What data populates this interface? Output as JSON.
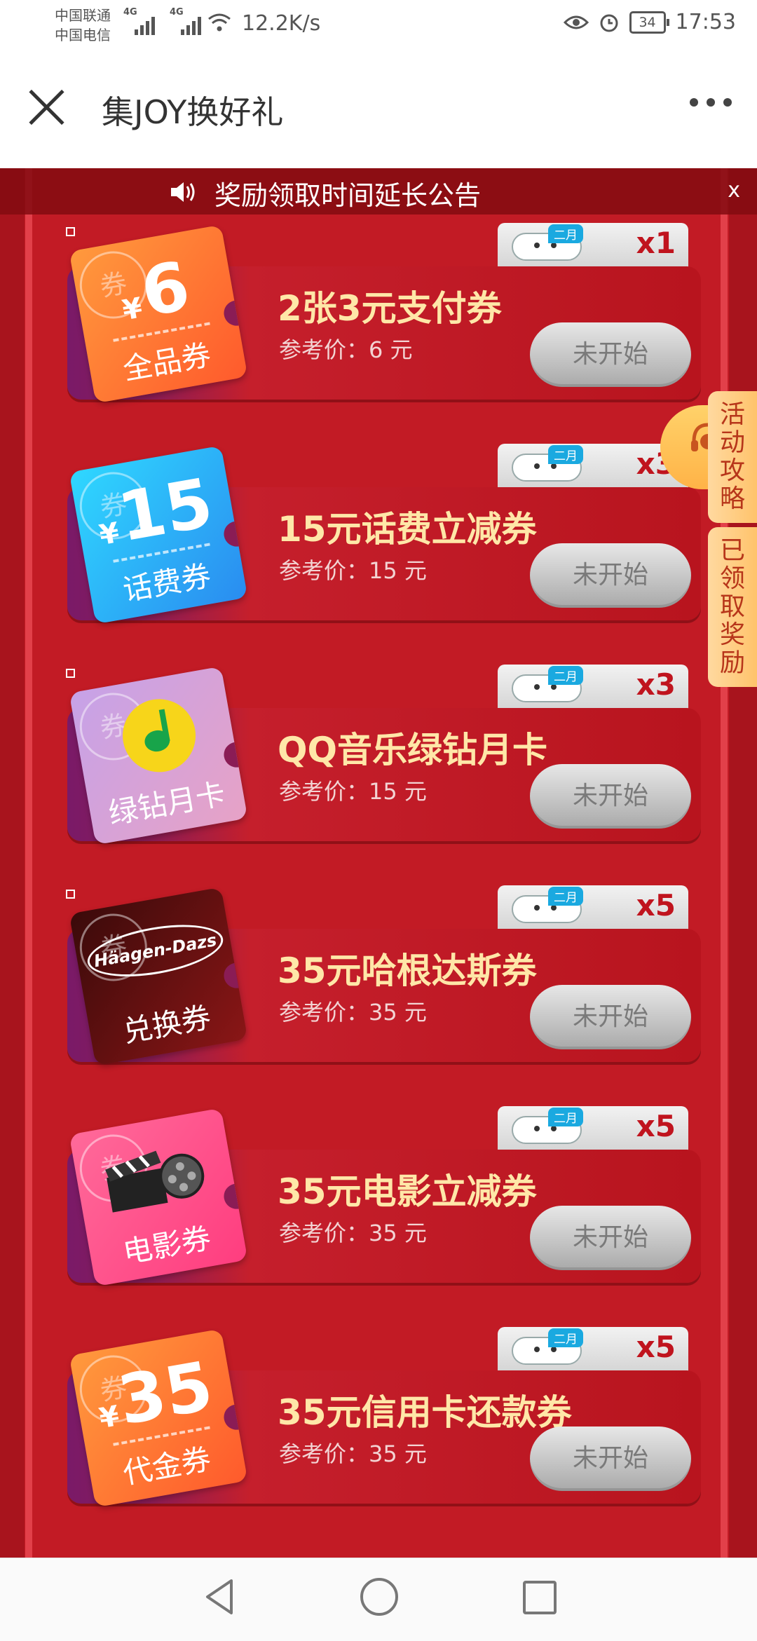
{
  "status_bar": {
    "carrier1": "中国联通",
    "carrier2": "中国电信",
    "net1": "4G",
    "net2": "4G",
    "speed": "12.2K/s",
    "battery": "34",
    "time": "17:53"
  },
  "header": {
    "title": "集JOY换好礼"
  },
  "notice": {
    "text": "奖励领取时间延长公告",
    "close": "x"
  },
  "side": {
    "strategy": "活动攻略",
    "claimed": "已领取奖励"
  },
  "items": [
    {
      "coupon_amount": "6",
      "coupon_label": "全品券",
      "name": "2张3元支付券",
      "ref_price": "参考价：6 元",
      "month_badge": "二月",
      "count": "x1",
      "button": "未开始"
    },
    {
      "coupon_amount": "15",
      "coupon_label": "话费券",
      "name": "15元话费立减券",
      "ref_price": "参考价：15 元",
      "month_badge": "二月",
      "count": "x3",
      "button": "未开始"
    },
    {
      "coupon_amount": "",
      "coupon_label": "绿钻月卡",
      "name": "QQ音乐绿钻月卡",
      "ref_price": "参考价：15 元",
      "month_badge": "二月",
      "count": "x3",
      "button": "未开始"
    },
    {
      "coupon_amount": "Häagen-Dazs",
      "coupon_label": "兑换券",
      "name": "35元哈根达斯券",
      "ref_price": "参考价：35 元",
      "month_badge": "二月",
      "count": "x5",
      "button": "未开始"
    },
    {
      "coupon_amount": "",
      "coupon_label": "电影券",
      "name": "35元电影立减券",
      "ref_price": "参考价：35 元",
      "month_badge": "二月",
      "count": "x5",
      "button": "未开始"
    },
    {
      "coupon_amount": "35",
      "coupon_label": "代金券",
      "name": "35元信用卡还款券",
      "ref_price": "参考价：35 元",
      "month_badge": "二月",
      "count": "x5",
      "button": "未开始"
    }
  ],
  "coupon_stamp": "券",
  "currency": "¥",
  "icons": {
    "close": "close-icon",
    "more": "more-icon",
    "speaker": "speaker-icon",
    "customer_service": "headset-icon",
    "joy": "joy-dog-icon",
    "nav_back": "back-triangle-icon",
    "nav_home": "home-circle-icon",
    "nav_recent": "recent-square-icon"
  },
  "colors": {
    "background_red": "#c21b25",
    "gift_name": "#ffe7a8",
    "count_red": "#c0141e",
    "button_gray": "#a9a9a9"
  }
}
